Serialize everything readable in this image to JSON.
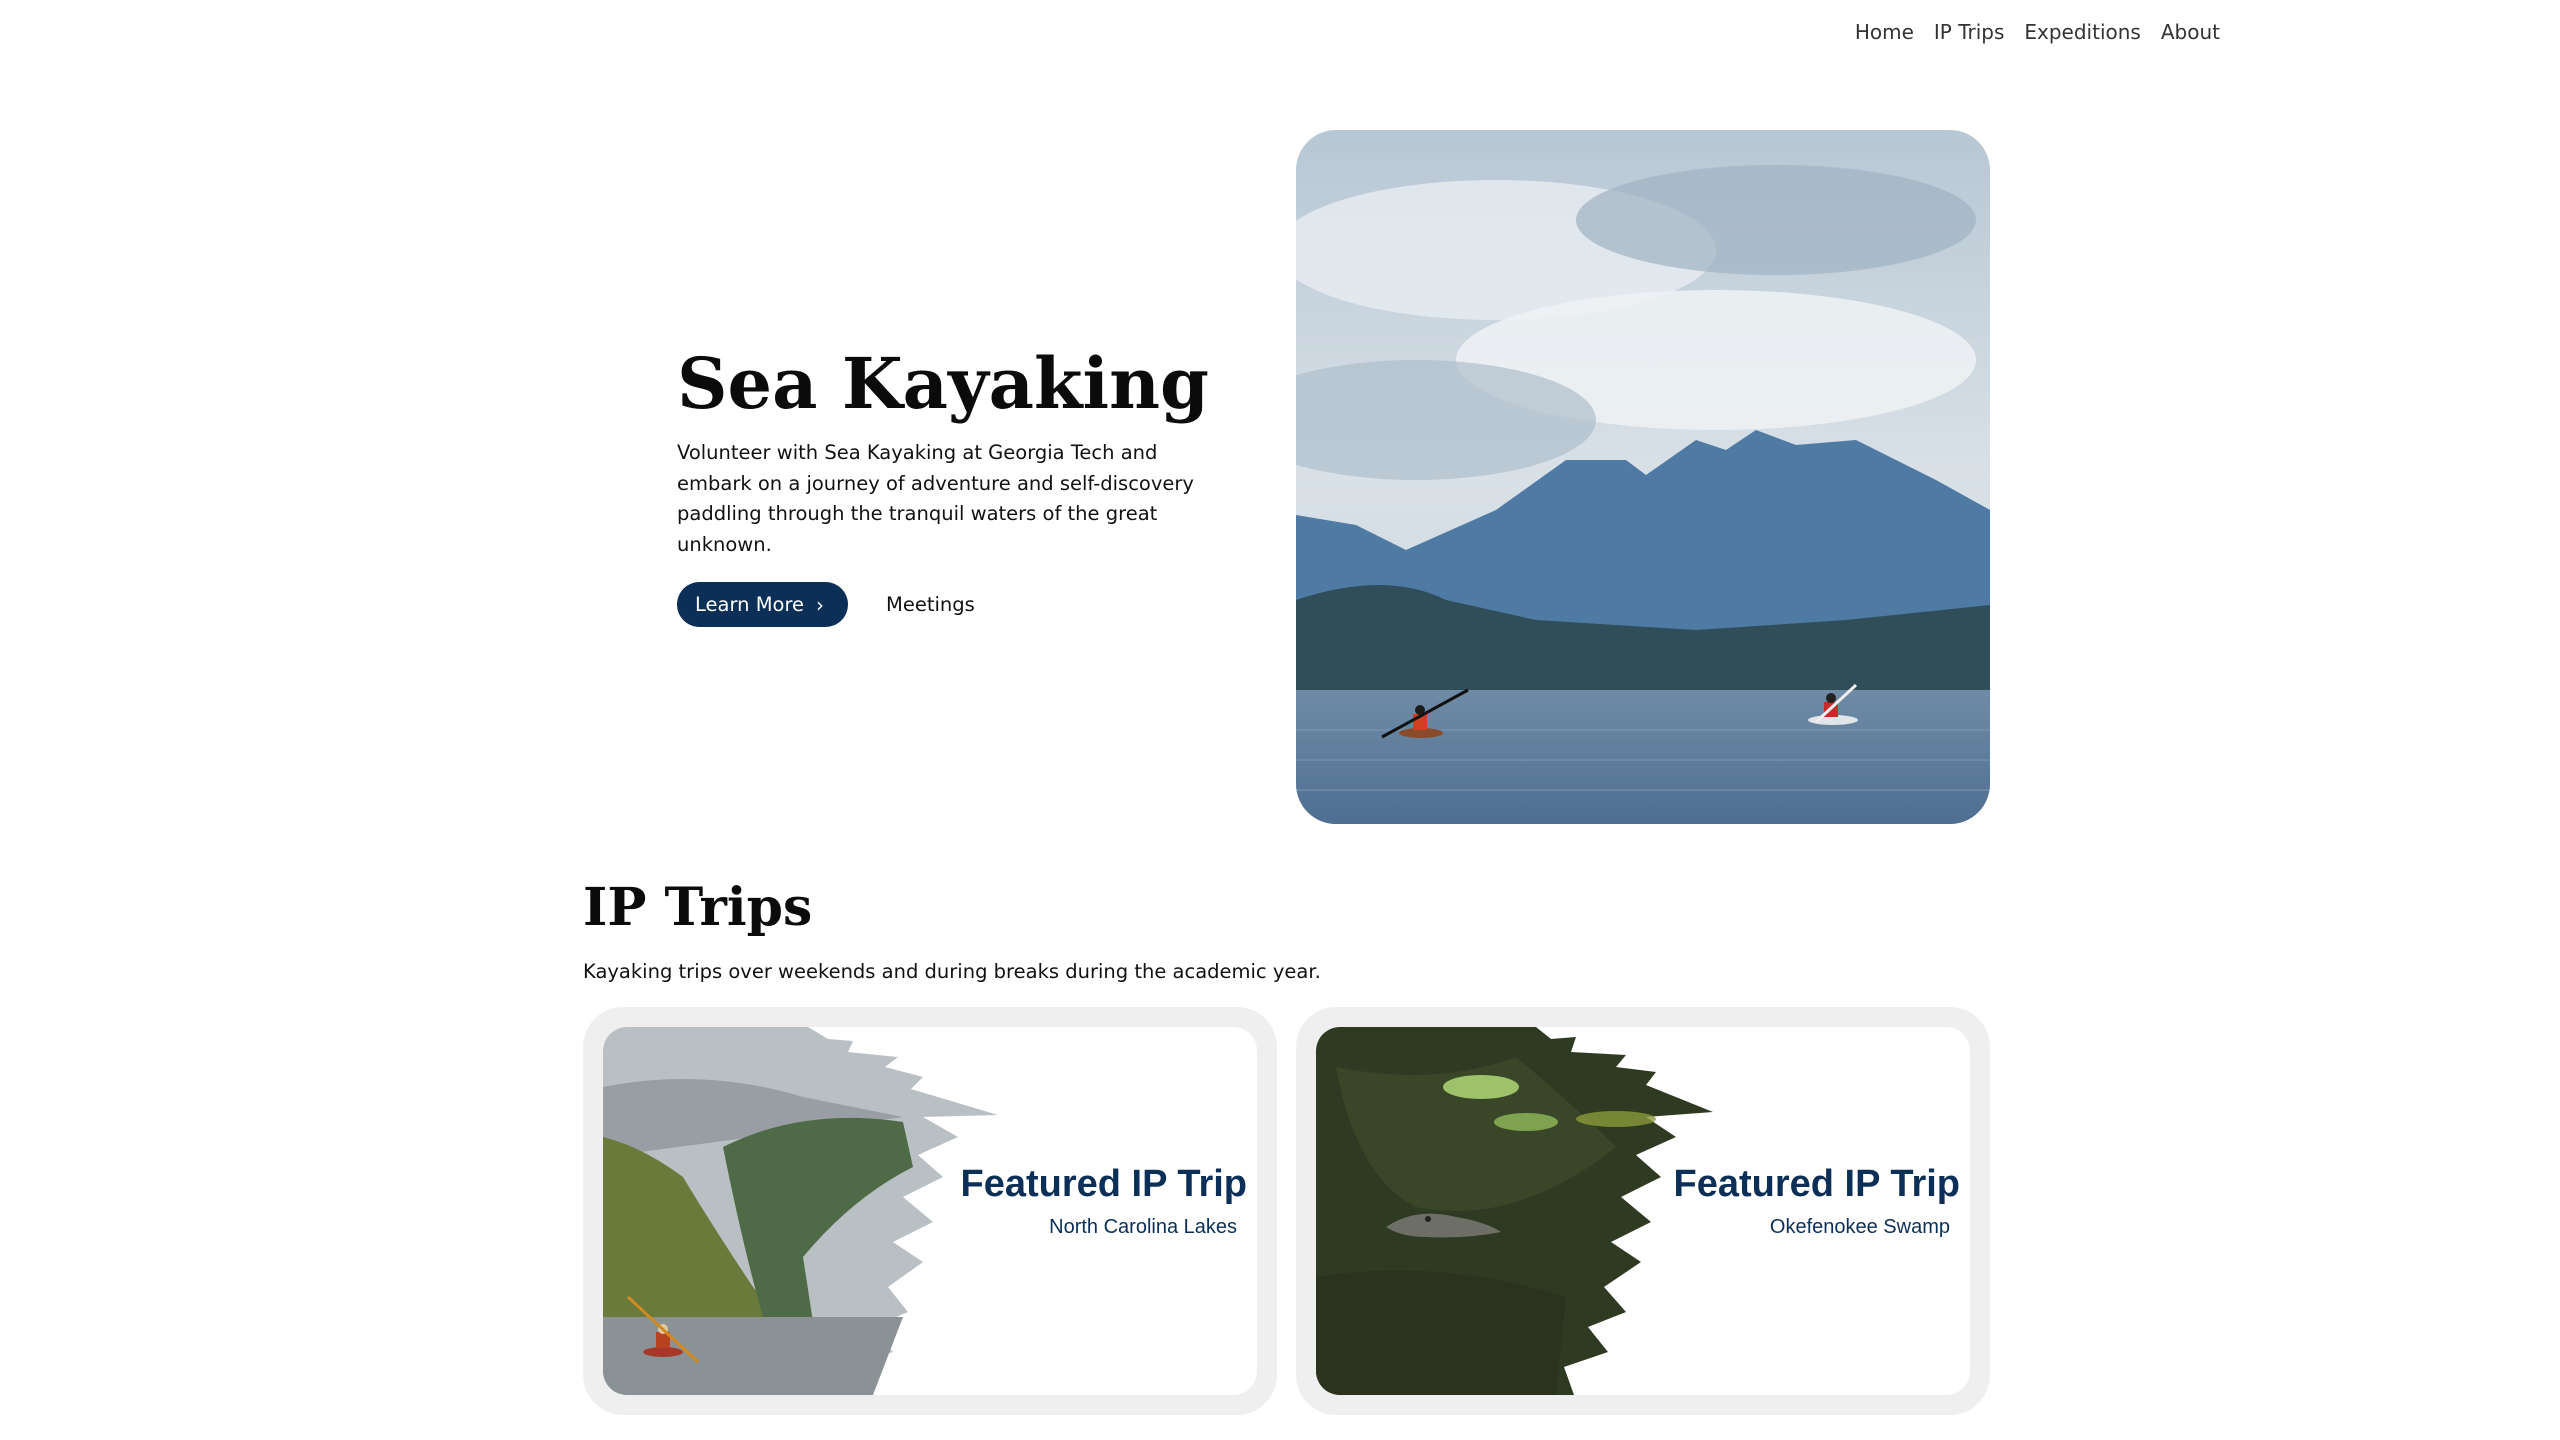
{
  "nav": {
    "items": [
      {
        "label": "Home"
      },
      {
        "label": "IP Trips"
      },
      {
        "label": "Expeditions"
      },
      {
        "label": "About"
      }
    ]
  },
  "hero": {
    "title": "Sea Kayaking",
    "description": "Volunteer with Sea Kayaking at Georgia Tech and embark on a journey of adventure and self-discovery paddling through the tranquil waters of the great unknown.",
    "primary_label": "Learn More",
    "secondary_label": "Meetings"
  },
  "ip_trips": {
    "title": "IP Trips",
    "description": "Kayaking trips over weekends and during breaks during the academic year.",
    "cards": [
      {
        "title": "Featured IP Trip",
        "subtitle": "North Carolina Lakes"
      },
      {
        "title": "Featured IP Trip",
        "subtitle": "Okefenokee Swamp"
      }
    ]
  },
  "colors": {
    "accent": "#0b2f56",
    "card_bg": "#efefef"
  }
}
